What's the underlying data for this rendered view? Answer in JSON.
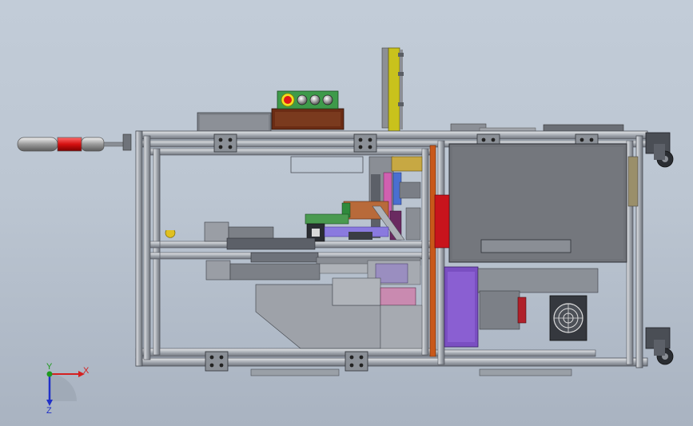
{
  "scene": {
    "view": "top",
    "model": "assembly-machine-frame",
    "background_top": "#c2ccd8",
    "background_bottom": "#a9b3c1"
  },
  "triad": {
    "x_label": "X",
    "y_label": "Y",
    "z_label": "Z",
    "x_color": "#d42020",
    "y_color": "#1e9a1e",
    "z_color": "#2030c8"
  },
  "colors": {
    "frame": "#a9aeb5",
    "frame_dark": "#5d6169",
    "cabinet": "#6f7278",
    "yellow_rail": "#c9c21c",
    "orange_divider": "#c8581a",
    "red_block": "#c8141c",
    "purple_panel": "#7a4fc2",
    "panel_green": "#2f8a3c",
    "stack_light_red": "#d41010",
    "estop": "#e01818"
  },
  "status_light": {
    "color": "red"
  },
  "control_panel": {
    "button_count": 3,
    "has_estop": true
  },
  "fan": {
    "count": 1
  },
  "casters": {
    "count": 2
  }
}
